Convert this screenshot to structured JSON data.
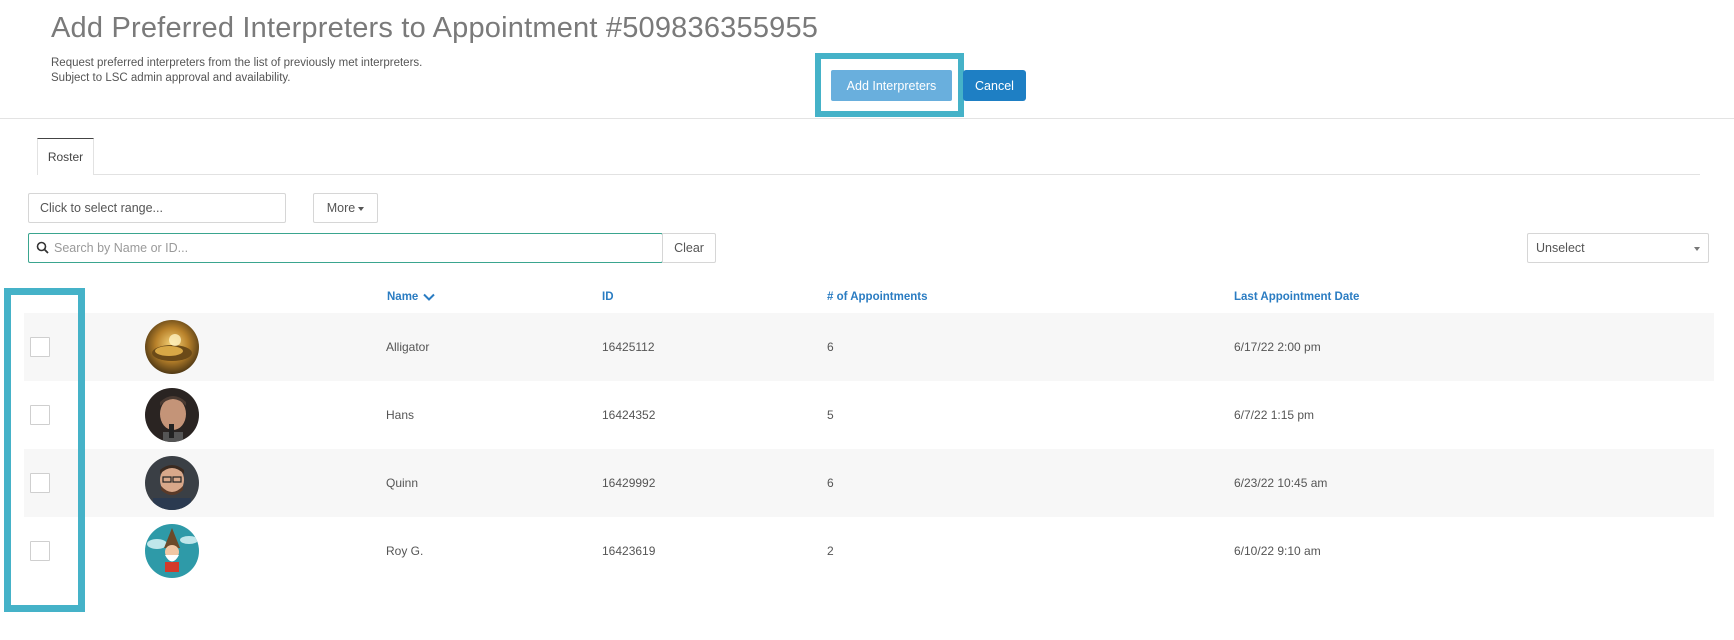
{
  "header": {
    "title": "Add Preferred Interpreters to Appointment #509836355955",
    "subtitle_line1": "Request preferred interpreters from the list of previously met interpreters.",
    "subtitle_line2": "Subject to LSC admin approval and availability.",
    "add_button_label": "Add Interpreters",
    "cancel_button_label": "Cancel"
  },
  "tabs": [
    {
      "label": "Roster",
      "active": true
    }
  ],
  "filters": {
    "range_placeholder": "Click to select range...",
    "more_label": "More",
    "search_placeholder": "Search by Name or ID...",
    "clear_label": "Clear",
    "select_value": "Unselect"
  },
  "table": {
    "columns": {
      "name": "Name",
      "id": "ID",
      "appointments": "# of Appointments",
      "last_date": "Last Appointment Date"
    },
    "sort": {
      "column": "name",
      "icon": "chevron-down-icon"
    },
    "rows": [
      {
        "name": "Alligator",
        "id": "16425112",
        "appointments": "6",
        "last_date": "6/17/22 2:00 pm",
        "avatar": "golden-alligator-avatar"
      },
      {
        "name": "Hans",
        "id": "16424352",
        "appointments": "5",
        "last_date": "6/7/22 1:15 pm",
        "avatar": "man-portrait-avatar"
      },
      {
        "name": "Quinn",
        "id": "16429992",
        "appointments": "6",
        "last_date": "6/23/22 10:45 am",
        "avatar": "man-glasses-avatar"
      },
      {
        "name": "Roy G.",
        "id": "16423619",
        "appointments": "2",
        "last_date": "6/10/22 9:10 am",
        "avatar": "gnome-cartoon-avatar"
      }
    ]
  },
  "colors": {
    "highlight": "#45b2c8",
    "primary": "#1e7fc4",
    "primary_light": "#69afdd",
    "link": "#2a7cc2"
  }
}
